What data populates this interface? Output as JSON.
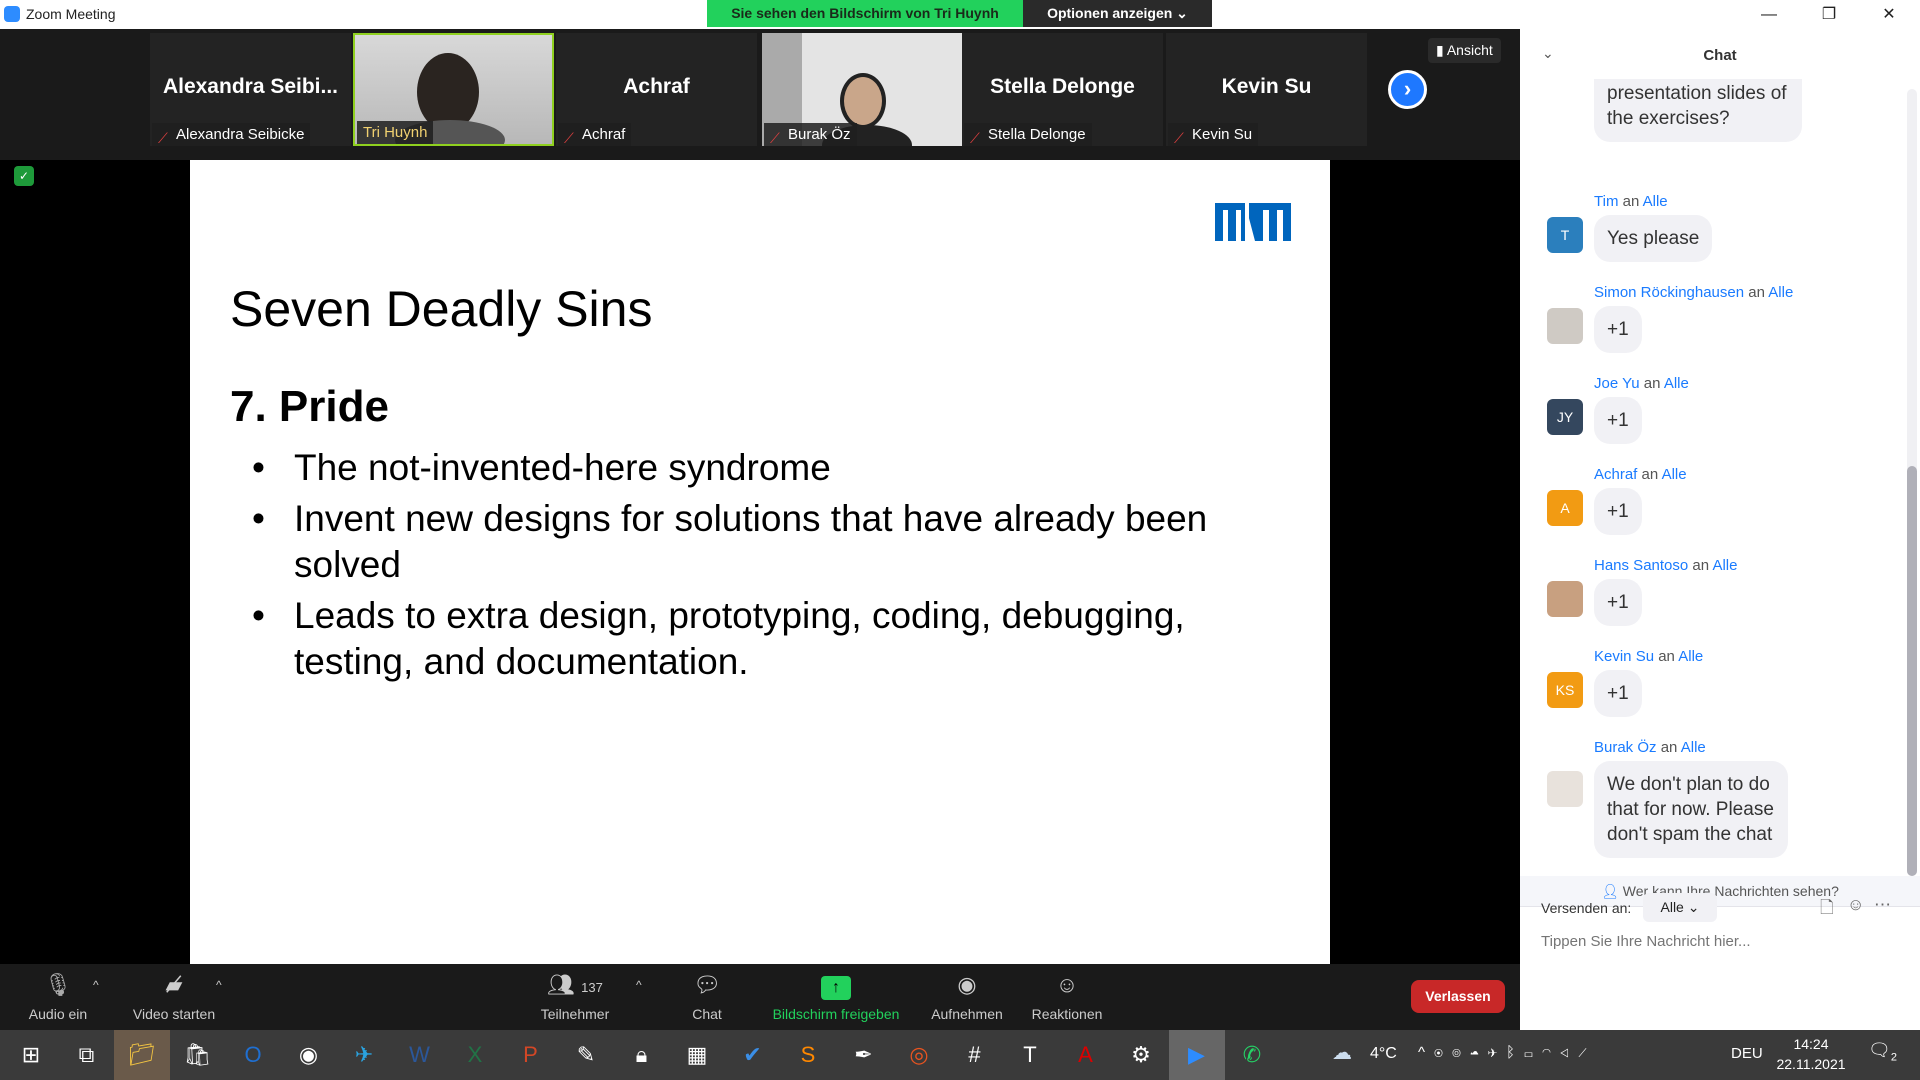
{
  "window": {
    "title": "Zoom Meeting",
    "minimize": "—",
    "restore": "❐",
    "close": "✕"
  },
  "banner": {
    "text": "Sie sehen den Bildschirm von Tri Huynh",
    "options": "Optionen anzeigen ⌄"
  },
  "gallery": {
    "view_label": "Ansicht",
    "tiles": [
      {
        "big": "Alexandra  Seibi...",
        "name": "Alexandra Seibicke",
        "video": false
      },
      {
        "big": "",
        "name": "Tri Huynh",
        "video": true
      },
      {
        "big": "Achraf",
        "name": "Achraf",
        "video": false
      },
      {
        "big": "",
        "name": "Burak Öz",
        "video": true
      },
      {
        "big": "Stella Delonge",
        "name": "Stella Delonge",
        "video": false
      },
      {
        "big": "Kevin Su",
        "name": "Kevin Su",
        "video": false
      }
    ],
    "next": "›"
  },
  "slide": {
    "logo": "TUM",
    "title": "Seven Deadly Sins",
    "subtitle": "7. Pride",
    "bullets": [
      "The not-invented-here syndrome",
      "Invent new designs for solutions that have already been solved",
      "Leads to extra design, prototyping, coding, debugging, testing, and documentation."
    ]
  },
  "toolbar": {
    "audio": "Audio ein",
    "video": "Video starten",
    "participants": "Teilnehmer",
    "participant_count": "137",
    "chat": "Chat",
    "share": "Bildschirm freigeben",
    "record": "Aufnehmen",
    "reactions": "Reaktionen",
    "leave": "Verlassen"
  },
  "chat": {
    "title": "Chat",
    "first_bubble": "presentation slides of the exercises?",
    "an": "an",
    "messages": [
      {
        "sender": "Tim",
        "to": "Alle",
        "initials": "T",
        "color": "#2b7fbd",
        "text": "Yes please"
      },
      {
        "sender": "Simon Röckinghausen",
        "to": "Alle",
        "initials": "",
        "color": "#cfcac4",
        "text": "+1"
      },
      {
        "sender": "Joe Yu",
        "to": "Alle",
        "initials": "JY",
        "color": "#34475e",
        "text": "+1"
      },
      {
        "sender": "Achraf",
        "to": "Alle",
        "initials": "A",
        "color": "#f29b13",
        "text": "+1"
      },
      {
        "sender": "Hans Santoso",
        "to": "Alle",
        "initials": "",
        "color": "#c8a080",
        "text": "+1"
      },
      {
        "sender": "Kevin Su",
        "to": "Alle",
        "initials": "KS",
        "color": "#f29b13",
        "text": "+1"
      },
      {
        "sender": "Burak Öz",
        "to": "Alle",
        "initials": "",
        "color": "#e8e2dc",
        "text": "We don't plan to do that for now. Please don't spam the chat"
      }
    ],
    "privacy": "Wer kann Ihre Nachrichten sehen?",
    "send_to_label": "Versenden an:",
    "recipient": "Alle",
    "input_placeholder": "Tippen Sie Ihre Nachricht hier..."
  },
  "taskbar": {
    "weather": "4°C",
    "language": "DEU",
    "time": "14:24",
    "date": "22.11.2021",
    "notifications": "2",
    "apps": [
      "windows-start",
      "task-view",
      "file-explorer",
      "microsoft-store",
      "outlook",
      "chrome-profile",
      "telegram",
      "word",
      "excel",
      "powerpoint",
      "paint",
      "keepass",
      "calculator",
      "vscode-like",
      "sublime-text",
      "inkscape",
      "ubuntu",
      "slack",
      "texstudio",
      "acrobat",
      "settings",
      "zoom",
      "whatsapp"
    ]
  }
}
